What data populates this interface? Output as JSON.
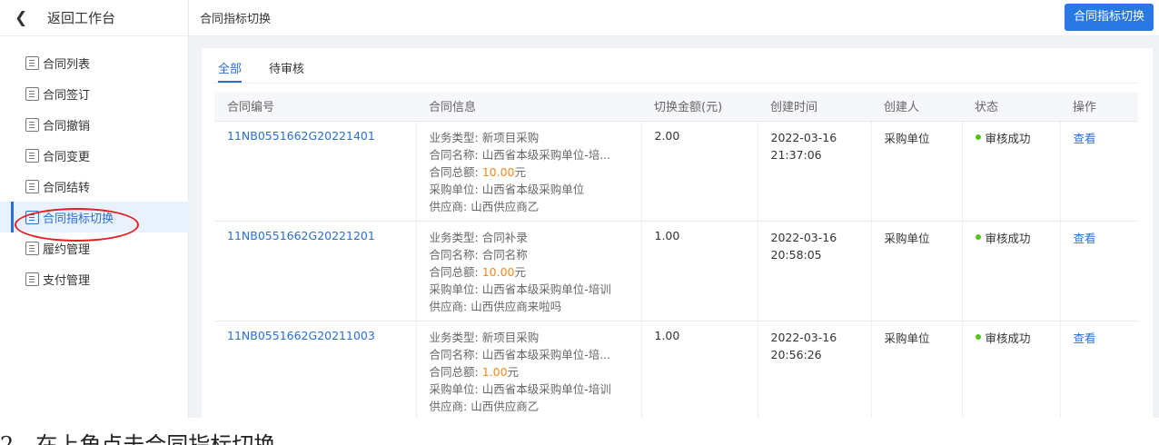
{
  "sidebar": {
    "back_label": "返回工作台",
    "items": [
      {
        "label": "合同列表"
      },
      {
        "label": "合同签订"
      },
      {
        "label": "合同撤销"
      },
      {
        "label": "合同变更"
      },
      {
        "label": "合同结转"
      },
      {
        "label": "合同指标切换"
      },
      {
        "label": "履约管理"
      },
      {
        "label": "支付管理"
      }
    ],
    "active_index": 5
  },
  "header": {
    "title": "合同指标切换",
    "button_label": "合同指标切换"
  },
  "tabs": [
    {
      "label": "全部",
      "active": true
    },
    {
      "label": "待审核",
      "active": false
    }
  ],
  "table": {
    "headers": [
      "合同编号",
      "合同信息",
      "切换金额(元)",
      "创建时间",
      "创建人",
      "状态",
      "操作"
    ],
    "rows": [
      {
        "code": "11NB0551662G20221401",
        "info": {
          "type_label": "业务类型:",
          "type": "新项目采购",
          "name_label": "合同名称:",
          "name": "山西省本级采购单位-培...",
          "total_label": "合同总额:",
          "total": "10.00",
          "total_unit": "元",
          "buyer_label": "采购单位:",
          "buyer": "山西省本级采购单位",
          "supplier_label": "供应商:",
          "supplier": "山西供应商乙"
        },
        "amount": "2.00",
        "date": "2022-03-16",
        "time": "21:37:06",
        "creator": "采购单位",
        "status": "审核成功",
        "action": "查看"
      },
      {
        "code": "11NB0551662G20221201",
        "info": {
          "type_label": "业务类型:",
          "type": "合同补录",
          "name_label": "合同名称:",
          "name": "合同名称",
          "total_label": "合同总额:",
          "total": "10.00",
          "total_unit": "元",
          "buyer_label": "采购单位:",
          "buyer": "山西省本级采购单位-培训",
          "supplier_label": "供应商:",
          "supplier": "山西供应商来啦吗"
        },
        "amount": "1.00",
        "date": "2022-03-16",
        "time": "20:58:05",
        "creator": "采购单位",
        "status": "审核成功",
        "action": "查看"
      },
      {
        "code": "11NB0551662G20211003",
        "info": {
          "type_label": "业务类型:",
          "type": "新项目采购",
          "name_label": "合同名称:",
          "name": "山西省本级采购单位-培...",
          "total_label": "合同总额:",
          "total": "1.00",
          "total_unit": "元",
          "buyer_label": "采购单位:",
          "buyer": "山西省本级采购单位-培训",
          "supplier_label": "供应商:",
          "supplier": "山西供应商乙"
        },
        "amount": "1.00",
        "date": "2022-03-16",
        "time": "20:56:26",
        "creator": "采购单位",
        "status": "审核成功",
        "action": "查看"
      }
    ]
  },
  "caption": "2、在上角点击合同指标切换",
  "colors": {
    "accent": "#2a78e4",
    "annotation": "#e02020",
    "success": "#52c41a",
    "amount": "#f0891a"
  }
}
